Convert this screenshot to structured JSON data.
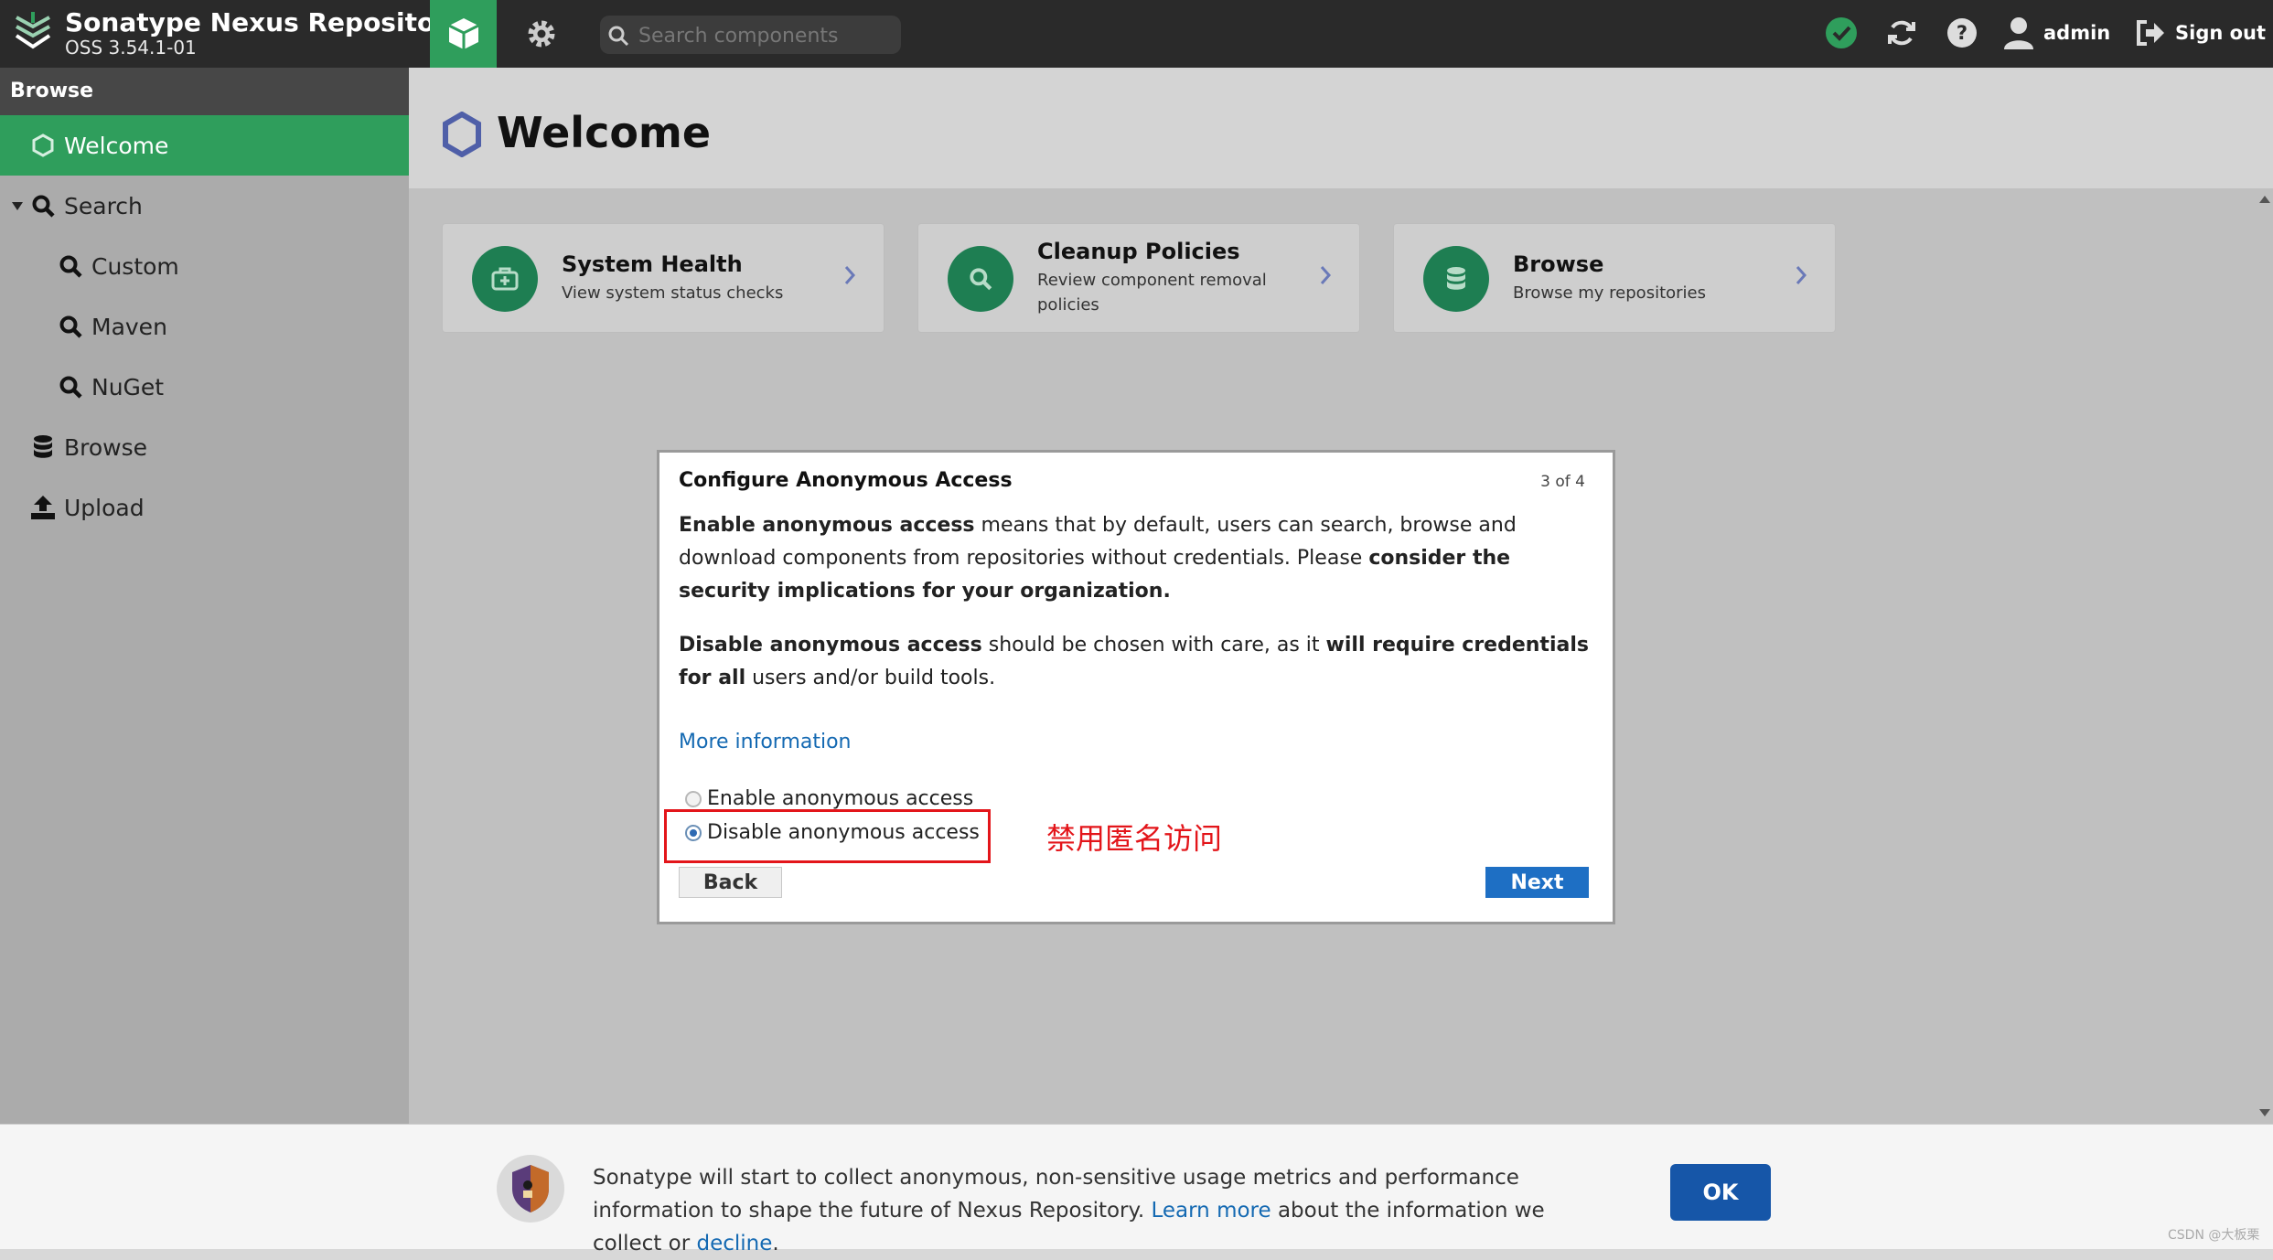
{
  "header": {
    "app_title": "Sonatype Nexus Repository",
    "app_version": "OSS 3.54.1-01",
    "search_placeholder": "Search components",
    "user_name": "admin",
    "signout_label": "Sign out",
    "icons": [
      "browse-cube-icon",
      "settings-gear-icon",
      "status-check-icon",
      "refresh-icon",
      "help-icon",
      "user-icon",
      "sign-out-icon"
    ]
  },
  "sidebar": {
    "heading": "Browse",
    "items": [
      {
        "label": "Welcome",
        "icon": "hexagon-icon",
        "active": true
      },
      {
        "label": "Search",
        "icon": "search-icon",
        "expanded": true
      },
      {
        "label": "Custom",
        "icon": "search-icon"
      },
      {
        "label": "Maven",
        "icon": "search-icon"
      },
      {
        "label": "NuGet",
        "icon": "search-icon"
      },
      {
        "label": "Browse",
        "icon": "database-icon"
      },
      {
        "label": "Upload",
        "icon": "upload-icon"
      }
    ]
  },
  "main": {
    "title": "Welcome",
    "cards": [
      {
        "title": "System Health",
        "desc": "View system status checks",
        "icon": "medkit-icon"
      },
      {
        "title": "Cleanup Policies",
        "desc": "Review component removal policies",
        "icon": "search-icon"
      },
      {
        "title": "Browse",
        "desc": "Browse my repositories",
        "icon": "database-icon"
      }
    ]
  },
  "dialog": {
    "title": "Configure Anonymous Access",
    "step": "3 of 4",
    "p1_b1": "Enable anonymous access",
    "p1_t1": " means that by default, users can search, browse and download components from repositories without credentials. Please ",
    "p1_b2": "consider the security implications for your organization.",
    "p2_b1": "Disable anonymous access",
    "p2_t1": " should be chosen with care, as it ",
    "p2_b2": "will require credentials for all",
    "p2_t2": " users and/or build tools.",
    "more_info": "More information",
    "options": [
      {
        "label": "Enable anonymous access",
        "selected": false
      },
      {
        "label": "Disable anonymous access",
        "selected": true
      }
    ],
    "back": "Back",
    "next": "Next"
  },
  "annotation": {
    "text": "禁用匿名访问",
    "color": "#e3151a"
  },
  "banner": {
    "t1": "Sonatype will start to collect anonymous, non-sensitive usage metrics and performance information to shape the future of Nexus Repository. ",
    "learn_more": "Learn more",
    "t2": " about the information we collect or ",
    "decline": "decline",
    "t3": ".",
    "ok": "OK"
  },
  "watermark": "CSDN @大板栗",
  "colors": {
    "accent_green": "#2f9e5c",
    "primary_blue": "#1e6fc4",
    "link_blue": "#1469b2"
  }
}
